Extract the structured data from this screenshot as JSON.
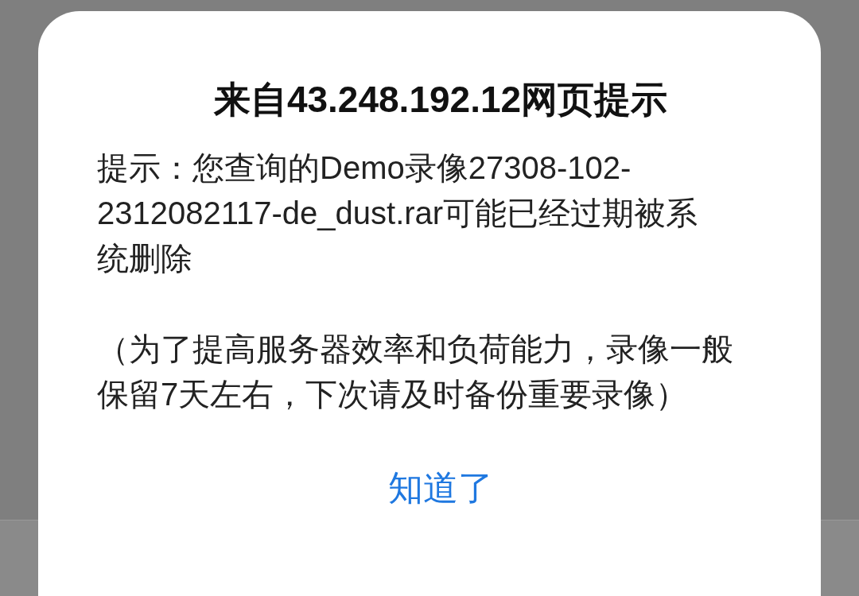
{
  "dialog": {
    "title": "来自43.248.192.12网页提示",
    "paragraphs": [
      "提示：您查询的Demo录像27308-102-2312082117-de_dust.rar可能已经过期被系统删除",
      "（为了提高服务器效率和负荷能力，录像一般保留7天左右，下次请及时备份重要录像）"
    ],
    "button": "知道了"
  }
}
